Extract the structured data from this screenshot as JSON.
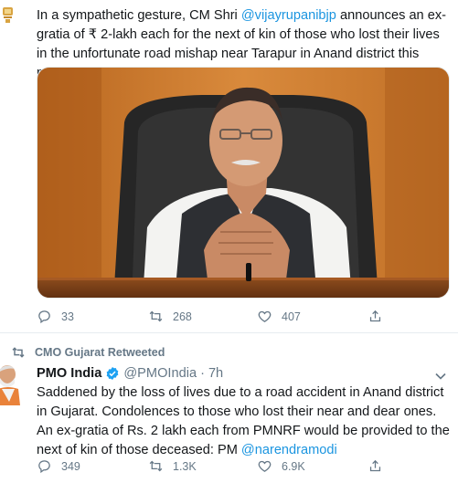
{
  "tweet1": {
    "text_prefix": "In a sympathetic gesture, CM Shri ",
    "mention": "@vijayrupanibjp",
    "text_suffix": " announces an ex-gratia of ₹ 2-lakh each for the next of kin of those who lost their lives in the unfortunate road mishap near Tarapur in Anand district this morning.",
    "replies": "33",
    "retweets": "268",
    "likes": "407"
  },
  "tweet2": {
    "retweeted_by": "CMO Gujarat Retweeted",
    "author_name": "PMO India",
    "author_handle": "@PMOIndia",
    "separator": "·",
    "time": "7h",
    "text_main": "Saddened by the loss of lives due to a road accident in Anand district in Gujarat. Condolences to those who lost their near and dear ones. An ex-gratia of Rs. 2 lakh each from PMNRF would be provided to the next of kin of those deceased: PM ",
    "mention": "@narendramodi",
    "replies": "349",
    "retweets": "1.3K",
    "likes": "6.9K"
  },
  "colors": {
    "accent": "#1b95e0",
    "muted": "#657786",
    "text": "#14171a",
    "divider": "#e6ecf0"
  },
  "icons": [
    "reply-icon",
    "retweet-icon",
    "like-icon",
    "share-icon",
    "verified-icon",
    "caret-down-icon"
  ]
}
